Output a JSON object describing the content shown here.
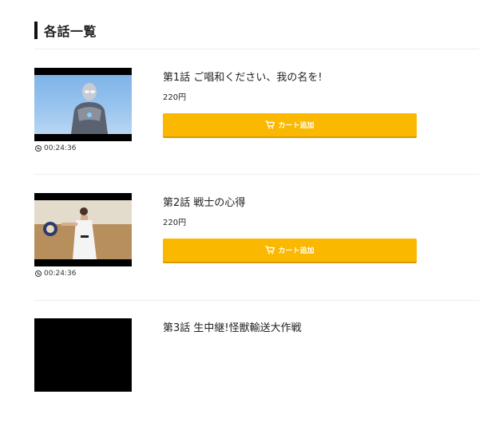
{
  "section": {
    "title": "各話一覧"
  },
  "episodes": [
    {
      "title": "第1話 ご唱和ください、我の名を!",
      "price": "220円",
      "cart_label": "カート追加",
      "duration": "00:24:36"
    },
    {
      "title": "第2話 戦士の心得",
      "price": "220円",
      "cart_label": "カート追加",
      "duration": "00:24:36"
    },
    {
      "title": "第3話 生中継!怪獣輸送大作戦",
      "price": "",
      "cart_label": "",
      "duration": ""
    }
  ],
  "colors": {
    "accent": "#fab800",
    "text": "#222222",
    "divider": "#eeeeee"
  },
  "icons": {
    "cart": "cart-icon",
    "clock": "clock-icon"
  }
}
